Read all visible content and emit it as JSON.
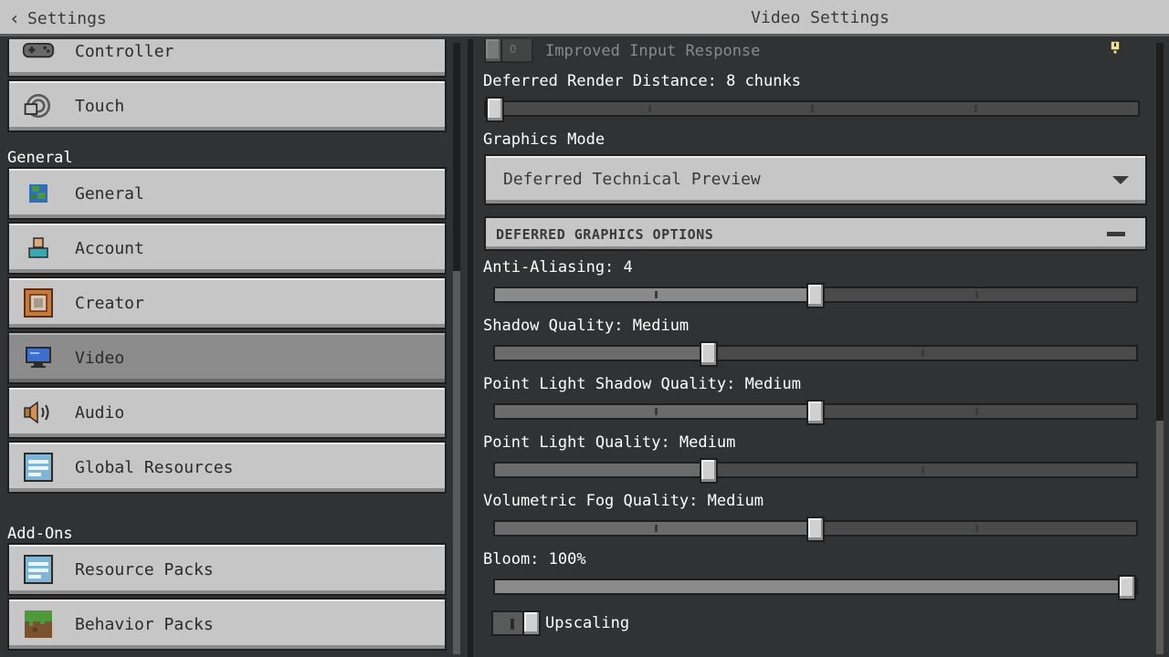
{
  "header": {
    "back_label": "Settings",
    "title": "Video Settings"
  },
  "sidebar": {
    "items_top": [
      {
        "label": "Controller",
        "icon": "controller-icon"
      },
      {
        "label": "Touch",
        "icon": "touch-icon"
      }
    ],
    "section_general": "General",
    "items_general": [
      {
        "label": "General",
        "icon": "globe-icon"
      },
      {
        "label": "Account",
        "icon": "account-icon"
      },
      {
        "label": "Creator",
        "icon": "creator-icon"
      },
      {
        "label": "Video",
        "icon": "monitor-icon",
        "selected": true
      },
      {
        "label": "Audio",
        "icon": "speaker-icon"
      },
      {
        "label": "Global Resources",
        "icon": "resources-icon"
      }
    ],
    "section_addons": "Add-Ons",
    "items_addons": [
      {
        "label": "Resource Packs",
        "icon": "resource-pack-icon"
      },
      {
        "label": "Behavior Packs",
        "icon": "behavior-pack-icon"
      }
    ]
  },
  "settings": {
    "improved_input": {
      "label": "Improved Input Response",
      "enabled": false
    },
    "render_distance": {
      "label": "Deferred Render Distance: 8 chunks",
      "fraction": 0.0
    },
    "graphics_mode": {
      "label": "Graphics Mode",
      "value": "Deferred Technical Preview"
    },
    "deferred_section": "DEFERRED GRAPHICS OPTIONS",
    "anti_aliasing": {
      "label": "Anti-Aliasing: 4",
      "fraction": 0.5
    },
    "shadow_quality": {
      "label": "Shadow Quality: Medium",
      "fraction": 0.333
    },
    "point_light_shadow": {
      "label": "Point Light Shadow Quality: Medium",
      "fraction": 0.5
    },
    "point_light_quality": {
      "label": "Point Light Quality: Medium",
      "fraction": 0.333
    },
    "volumetric_fog": {
      "label": "Volumetric Fog Quality: Medium",
      "fraction": 0.5
    },
    "bloom": {
      "label": "Bloom: 100%",
      "fraction": 1.0
    },
    "upscaling": {
      "label": "Upscaling",
      "enabled": true
    }
  },
  "colors": {
    "panel_bg": "#313233",
    "button_bg": "#c6c6c6",
    "selected_bg": "#8c8c8c",
    "text_dark": "#3a3a3a"
  }
}
